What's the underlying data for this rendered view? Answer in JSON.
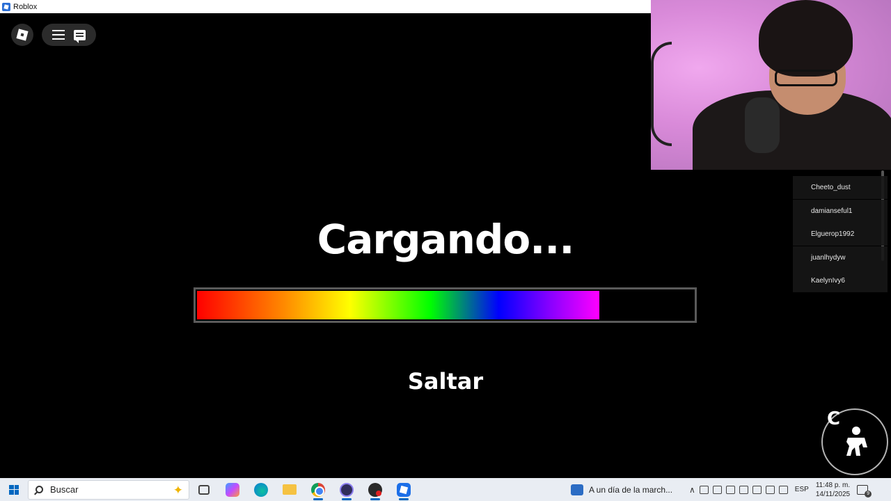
{
  "window": {
    "title": "Roblox"
  },
  "game": {
    "loading_text": "Cargando...",
    "progress_fraction": 0.81,
    "skip_label": "Saltar",
    "crouch_key": "C"
  },
  "players": [
    {
      "name": "Cheeto_dust"
    },
    {
      "name": "damianseful1"
    },
    {
      "name": "Elguerop1992"
    },
    {
      "name": "juanlhydyw"
    },
    {
      "name": "KaelynIvy6"
    }
  ],
  "taskbar": {
    "search_placeholder": "Buscar",
    "news_text": "A un día de la march...",
    "language": "ESP",
    "time": "11:48 p. m.",
    "date": "14/11/2025",
    "notification_count": "9",
    "accent_color": "#0067c0"
  },
  "icons": {
    "topbar": [
      "roblox-logo-icon",
      "hamburger-menu-icon",
      "chat-icon"
    ],
    "taskbar": [
      "windows-start-icon",
      "search-icon",
      "task-view-icon",
      "copilot-icon",
      "edge-icon",
      "file-explorer-icon",
      "chrome-icon",
      "obs-icon",
      "app-icon",
      "roblox-icon"
    ]
  }
}
